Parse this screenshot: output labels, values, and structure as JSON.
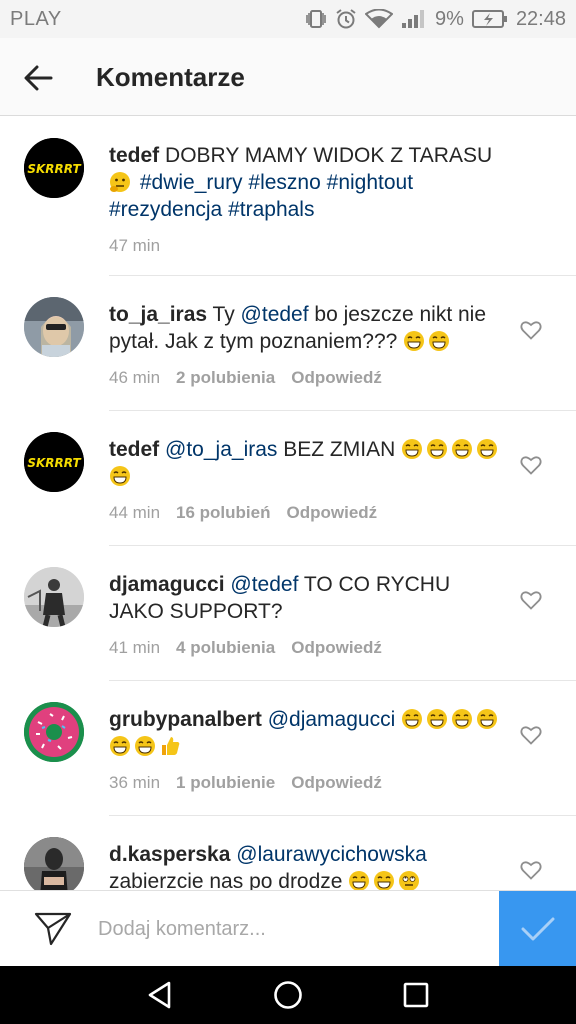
{
  "status_bar": {
    "carrier": "PLAY",
    "battery": "9%",
    "time": "22:48"
  },
  "header": {
    "title": "Komentarze"
  },
  "comments": [
    {
      "username": "tedef",
      "text_parts": [
        "DOBRY MAMY WIDOK Z TARASU"
      ],
      "tags": [
        "#dwie_rury",
        "#leszno",
        "#nightout",
        "#rezydencja",
        "#traphals"
      ],
      "time": "47 min"
    },
    {
      "username": "to_ja_iras",
      "pre": "Ty",
      "mention": "@tedef",
      "post": "bo jeszcze nikt nie pytał. Jak z tym poznaniem???",
      "time": "46 min",
      "likes": "2 polubienia",
      "reply": "Odpowiedź"
    },
    {
      "username": "tedef",
      "mention": "@to_ja_iras",
      "post": "BEZ ZMIAN",
      "time": "44 min",
      "likes": "16 polubień",
      "reply": "Odpowiedź"
    },
    {
      "username": "djamagucci",
      "mention": "@tedef",
      "post": "TO CO RYCHU JAKO SUPPORT?",
      "time": "41 min",
      "likes": "4 polubienia",
      "reply": "Odpowiedź"
    },
    {
      "username": "grubypanalbert",
      "mention": "@djamagucci",
      "time": "36 min",
      "likes": "1 polubienie",
      "reply": "Odpowiedź"
    },
    {
      "username": "d.kasperska",
      "mention": "@laurawycichowska",
      "post": "zabierzcie nas po drodze"
    }
  ],
  "avatar_badge": "SKRRRT",
  "input": {
    "placeholder": "Dodaj komentarz..."
  },
  "colors": {
    "link": "#003569",
    "accent": "#3897f0",
    "meta": "#a0a0a0"
  }
}
